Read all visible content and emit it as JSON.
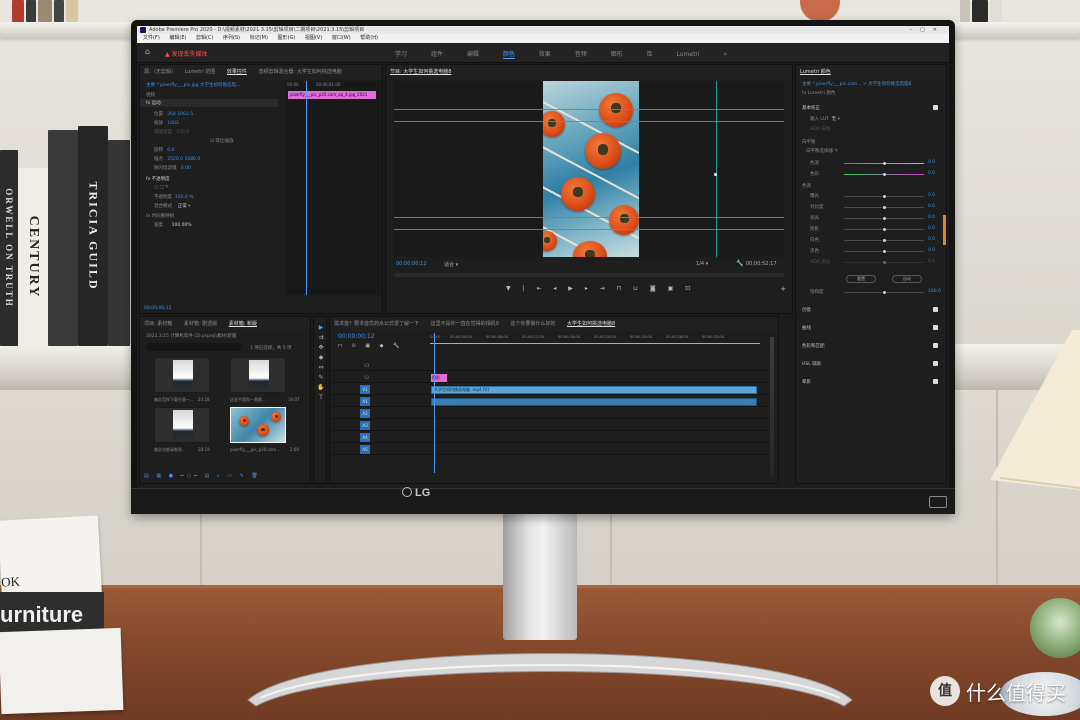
{
  "monitor": {
    "brand": "LG"
  },
  "desk_books": {
    "top_book_text": "OK",
    "bottom_book_text": "urniture"
  },
  "shelf_books": {
    "book1": "TRICIA GUILD",
    "book2": "CENTURY",
    "book3": "ORWELL ON TRUTH"
  },
  "watermark": {
    "text": "什么值得买"
  },
  "premiere": {
    "title": "Adobe Premiere Pro 2020 - D:\\视频素材\\2021.3.15\\剪辑项目\\二期项目\\2021.3.15\\剪辑项目",
    "menu": [
      "文件(F)",
      "编辑(E)",
      "剪辑(C)",
      "序列(S)",
      "标记(M)",
      "图形(G)",
      "视图(V)",
      "窗口(W)",
      "帮助(H)"
    ],
    "warning": "发现丢失媒体",
    "workspaces": [
      "学习",
      "组件",
      "编辑",
      "颜色",
      "效果",
      "音频",
      "图形",
      "库",
      "Lumetri"
    ],
    "active_workspace": "颜色",
    "effect_controls": {
      "tabs": [
        "源：(无剪辑)",
        "Lumetri 范围",
        "效果控件",
        "音频剪辑混合器: 大学生如何挑选电脑"
      ],
      "active_tab": "效果控件",
      "master": "主要 * pixerfly___pic.jpg 大学生如何挑选电...",
      "section_video": "视频",
      "fx_motion": "fx 运动",
      "rows": [
        {
          "label": "位置",
          "value": "264  1003.5"
        },
        {
          "label": "缩放",
          "value": "1003"
        },
        {
          "label": "缩放宽度",
          "value": "100.0"
        },
        {
          "label": "等比缩放",
          "value": ""
        },
        {
          "label": "旋转",
          "value": "0.0"
        },
        {
          "label": "锚点",
          "value": "2520.0  1680.0"
        },
        {
          "label": "防闪烁滤镜",
          "value": "0.00"
        }
      ],
      "fx_opacity": "fx 不透明度",
      "opacity_value": "100.0 %",
      "blend_label": "混合模式",
      "blend_value": "正常",
      "time_remap": "fx 时间重映射",
      "speed_label": "速度",
      "speed_value": "100.00%",
      "clip_name": "pixerfly___pic_p20.com_op_4.jpg_2021",
      "timecode_start": "00:00",
      "timecode_mid": "00;00;01;00",
      "bottom_tc": "00;00;00;12"
    },
    "program": {
      "tab": "节目: 大学生如何挑选电脑8",
      "timecode": "00;00;00;12",
      "fit": "适合",
      "ratio": "1/4",
      "duration": "00;00;52;17"
    },
    "lumetri": {
      "tab": "Lumetri 颜色",
      "master": "主要 * pixerfly___pic.com... > 大学生如何挑选电脑8",
      "fx": "fx  Lumetri 颜色",
      "basic": "基本校正",
      "input_lut": "输入 LUT",
      "input_lut_value": "无",
      "hdr_white": "HDR 白色",
      "white_balance": "白平衡",
      "wb_selector": "白平衡选择器",
      "sliders": [
        {
          "label": "色温",
          "value": "0.0"
        },
        {
          "label": "色彩",
          "value": "0.0"
        },
        {
          "label": "色调",
          "value": ""
        },
        {
          "label": "曝光",
          "value": "0.0"
        },
        {
          "label": "对比度",
          "value": "0.0"
        },
        {
          "label": "高光",
          "value": "0.0"
        },
        {
          "label": "阴影",
          "value": "0.0"
        },
        {
          "label": "白色",
          "value": "0.0"
        },
        {
          "label": "黑色",
          "value": "0.0"
        },
        {
          "label": "HDR 高光",
          "value": "0.0"
        }
      ],
      "reset": "重置",
      "auto": "自动",
      "saturation_label": "饱和度",
      "saturation_value": "100.0",
      "sections": [
        "创意",
        "曲线",
        "色轮和匹配",
        "HSL 辅助",
        "晕影"
      ]
    },
    "project": {
      "tabs": [
        "项目: 素材箱",
        "素材箱: 剧透版",
        "素材箱: 新版",
        "素材箱: 新版"
      ],
      "path": "2021.3.15 计算机软件 (2).prproj\\素材\\新版",
      "count": "1 项已选择，共 5 项",
      "items": [
        {
          "name": "偏总怎样下载任意一...",
          "dur": "24:18"
        },
        {
          "name": "这里不是你一直都...",
          "dur": "16:07"
        },
        {
          "name": "偏总也能录制到...",
          "dur": "28:19"
        },
        {
          "name": "pixerfly___pic_p20.com...",
          "dur": "2:00"
        }
      ]
    },
    "timeline": {
      "tabs": [
        "需求首？要求首优的水公式很了解一下",
        "这里不是你一直在觉得的相机9",
        "这个你要做什么好的",
        "大学生如何挑选电脑8"
      ],
      "timecode": "00;00;00;12",
      "ruler": [
        "00;00",
        "00;00;04;00",
        "00;00;08;00",
        "00;00;12;00",
        "00;00;16;00",
        "00;00;20;00",
        "00;00;24;00",
        "00;00;28;00",
        "00;00;32;00"
      ],
      "tracks": [
        "V3",
        "V2",
        "V1",
        "A1",
        "A2",
        "A3",
        "A4",
        "A5"
      ],
      "video_clip": "大学生如何挑选电脑 .mp4 [V]",
      "graphic_clip": "图形"
    }
  },
  "colors": {
    "accent": "#4b9bff",
    "clip_pink": "#e06bd9",
    "clip_blue": "#5aa5d9",
    "guide": "#23a8a0",
    "warning": "#ff4d4d"
  }
}
